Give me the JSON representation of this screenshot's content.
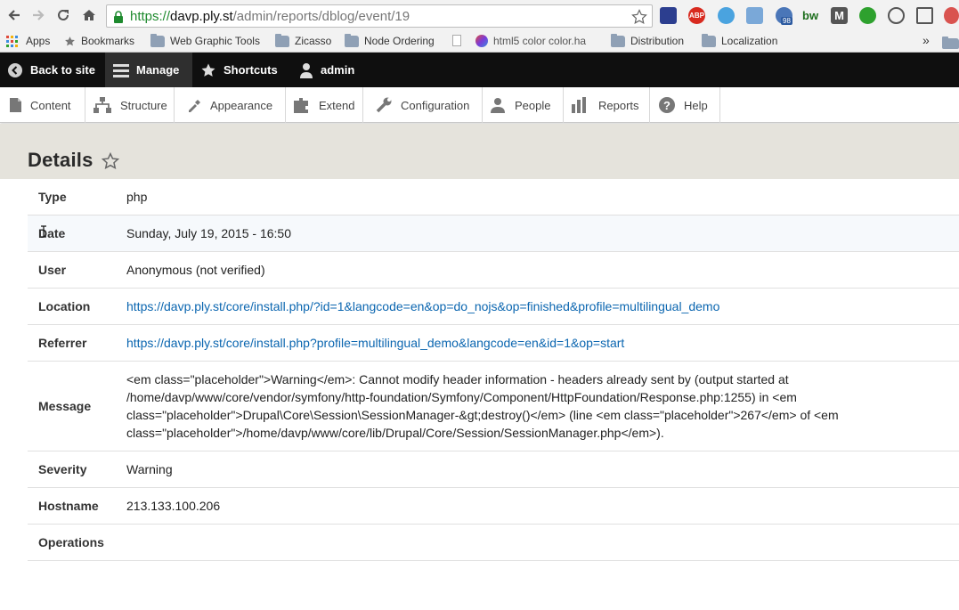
{
  "browser": {
    "url_scheme": "https://",
    "url_domain": "davp.ply.st",
    "url_path": "/admin/reports/dblog/event/19",
    "badge_count": "98",
    "bookmarks": [
      {
        "label": "Apps",
        "icon": "apps-grid-icon"
      },
      {
        "label": "Bookmarks",
        "icon": "star-icon"
      },
      {
        "label": "Web Graphic Tools",
        "icon": "folder-icon"
      },
      {
        "label": "Zicasso",
        "icon": "folder-icon"
      },
      {
        "label": "Node Ordering",
        "icon": "folder-icon"
      },
      {
        "label": "html5 color color.ha",
        "icon": "page-icon"
      },
      {
        "label": "Distribution",
        "icon": "folder-icon"
      },
      {
        "label": "Localization",
        "icon": "folder-icon"
      }
    ],
    "more_bookmarks": "»"
  },
  "admin_bar": {
    "back_label": "Back to site",
    "manage_label": "Manage",
    "shortcuts_label": "Shortcuts",
    "user_label": "admin"
  },
  "tray": {
    "items": [
      {
        "label": "Content",
        "icon": "content-icon"
      },
      {
        "label": "Structure",
        "icon": "structure-icon"
      },
      {
        "label": "Appearance",
        "icon": "appearance-icon"
      },
      {
        "label": "Extend",
        "icon": "extend-icon"
      },
      {
        "label": "Configuration",
        "icon": "configuration-icon"
      },
      {
        "label": "People",
        "icon": "people-icon"
      },
      {
        "label": "Reports",
        "icon": "reports-icon"
      },
      {
        "label": "Help",
        "icon": "help-icon"
      }
    ]
  },
  "page": {
    "title": "Details"
  },
  "details": {
    "rows": [
      {
        "label": "Type",
        "value": "php"
      },
      {
        "label": "Date",
        "value": "Sunday, July 19, 2015 - 16:50"
      },
      {
        "label": "User",
        "value": "Anonymous (not verified)"
      },
      {
        "label": "Location",
        "value": "https://davp.ply.st/core/install.php/?id=1&langcode=en&op=do_nojs&op=finished&profile=multilingual_demo"
      },
      {
        "label": "Referrer",
        "value": "https://davp.ply.st/core/install.php?profile=multilingual_demo&langcode=en&id=1&op=start"
      },
      {
        "label": "Message",
        "value": "<em class=\"placeholder\">Warning</em>: Cannot modify header information - headers already sent by (output started at /home/davp/www/core/vendor/symfony/http-foundation/Symfony/Component/HttpFoundation/Response.php:1255) in <em class=\"placeholder\">Drupal\\Core\\Session\\SessionManager-&gt;destroy()</em> (line <em class=\"placeholder\">267</em> of <em class=\"placeholder\">/home/davp/www/core/lib/Drupal/Core/Session/SessionManager.php</em>)."
      },
      {
        "label": "Severity",
        "value": "Warning"
      },
      {
        "label": "Hostname",
        "value": "213.133.100.206"
      },
      {
        "label": "Operations",
        "value": ""
      }
    ]
  },
  "colors": {
    "admin_bar": "#0f0f0f",
    "page_header": "#e5e3dc",
    "link": "#0b66b0"
  }
}
